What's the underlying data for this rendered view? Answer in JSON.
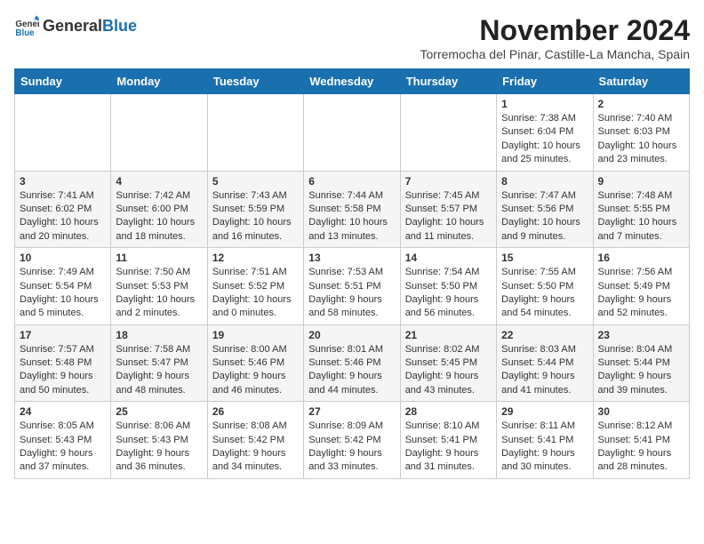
{
  "header": {
    "logo_general": "General",
    "logo_blue": "Blue",
    "month_title": "November 2024",
    "location": "Torremocha del Pinar, Castille-La Mancha, Spain"
  },
  "weekdays": [
    "Sunday",
    "Monday",
    "Tuesday",
    "Wednesday",
    "Thursday",
    "Friday",
    "Saturday"
  ],
  "weeks": [
    [
      {
        "day": "",
        "info": ""
      },
      {
        "day": "",
        "info": ""
      },
      {
        "day": "",
        "info": ""
      },
      {
        "day": "",
        "info": ""
      },
      {
        "day": "",
        "info": ""
      },
      {
        "day": "1",
        "info": "Sunrise: 7:38 AM\nSunset: 6:04 PM\nDaylight: 10 hours and 25 minutes."
      },
      {
        "day": "2",
        "info": "Sunrise: 7:40 AM\nSunset: 6:03 PM\nDaylight: 10 hours and 23 minutes."
      }
    ],
    [
      {
        "day": "3",
        "info": "Sunrise: 7:41 AM\nSunset: 6:02 PM\nDaylight: 10 hours and 20 minutes."
      },
      {
        "day": "4",
        "info": "Sunrise: 7:42 AM\nSunset: 6:00 PM\nDaylight: 10 hours and 18 minutes."
      },
      {
        "day": "5",
        "info": "Sunrise: 7:43 AM\nSunset: 5:59 PM\nDaylight: 10 hours and 16 minutes."
      },
      {
        "day": "6",
        "info": "Sunrise: 7:44 AM\nSunset: 5:58 PM\nDaylight: 10 hours and 13 minutes."
      },
      {
        "day": "7",
        "info": "Sunrise: 7:45 AM\nSunset: 5:57 PM\nDaylight: 10 hours and 11 minutes."
      },
      {
        "day": "8",
        "info": "Sunrise: 7:47 AM\nSunset: 5:56 PM\nDaylight: 10 hours and 9 minutes."
      },
      {
        "day": "9",
        "info": "Sunrise: 7:48 AM\nSunset: 5:55 PM\nDaylight: 10 hours and 7 minutes."
      }
    ],
    [
      {
        "day": "10",
        "info": "Sunrise: 7:49 AM\nSunset: 5:54 PM\nDaylight: 10 hours and 5 minutes."
      },
      {
        "day": "11",
        "info": "Sunrise: 7:50 AM\nSunset: 5:53 PM\nDaylight: 10 hours and 2 minutes."
      },
      {
        "day": "12",
        "info": "Sunrise: 7:51 AM\nSunset: 5:52 PM\nDaylight: 10 hours and 0 minutes."
      },
      {
        "day": "13",
        "info": "Sunrise: 7:53 AM\nSunset: 5:51 PM\nDaylight: 9 hours and 58 minutes."
      },
      {
        "day": "14",
        "info": "Sunrise: 7:54 AM\nSunset: 5:50 PM\nDaylight: 9 hours and 56 minutes."
      },
      {
        "day": "15",
        "info": "Sunrise: 7:55 AM\nSunset: 5:50 PM\nDaylight: 9 hours and 54 minutes."
      },
      {
        "day": "16",
        "info": "Sunrise: 7:56 AM\nSunset: 5:49 PM\nDaylight: 9 hours and 52 minutes."
      }
    ],
    [
      {
        "day": "17",
        "info": "Sunrise: 7:57 AM\nSunset: 5:48 PM\nDaylight: 9 hours and 50 minutes."
      },
      {
        "day": "18",
        "info": "Sunrise: 7:58 AM\nSunset: 5:47 PM\nDaylight: 9 hours and 48 minutes."
      },
      {
        "day": "19",
        "info": "Sunrise: 8:00 AM\nSunset: 5:46 PM\nDaylight: 9 hours and 46 minutes."
      },
      {
        "day": "20",
        "info": "Sunrise: 8:01 AM\nSunset: 5:46 PM\nDaylight: 9 hours and 44 minutes."
      },
      {
        "day": "21",
        "info": "Sunrise: 8:02 AM\nSunset: 5:45 PM\nDaylight: 9 hours and 43 minutes."
      },
      {
        "day": "22",
        "info": "Sunrise: 8:03 AM\nSunset: 5:44 PM\nDaylight: 9 hours and 41 minutes."
      },
      {
        "day": "23",
        "info": "Sunrise: 8:04 AM\nSunset: 5:44 PM\nDaylight: 9 hours and 39 minutes."
      }
    ],
    [
      {
        "day": "24",
        "info": "Sunrise: 8:05 AM\nSunset: 5:43 PM\nDaylight: 9 hours and 37 minutes."
      },
      {
        "day": "25",
        "info": "Sunrise: 8:06 AM\nSunset: 5:43 PM\nDaylight: 9 hours and 36 minutes."
      },
      {
        "day": "26",
        "info": "Sunrise: 8:08 AM\nSunset: 5:42 PM\nDaylight: 9 hours and 34 minutes."
      },
      {
        "day": "27",
        "info": "Sunrise: 8:09 AM\nSunset: 5:42 PM\nDaylight: 9 hours and 33 minutes."
      },
      {
        "day": "28",
        "info": "Sunrise: 8:10 AM\nSunset: 5:41 PM\nDaylight: 9 hours and 31 minutes."
      },
      {
        "day": "29",
        "info": "Sunrise: 8:11 AM\nSunset: 5:41 PM\nDaylight: 9 hours and 30 minutes."
      },
      {
        "day": "30",
        "info": "Sunrise: 8:12 AM\nSunset: 5:41 PM\nDaylight: 9 hours and 28 minutes."
      }
    ]
  ]
}
